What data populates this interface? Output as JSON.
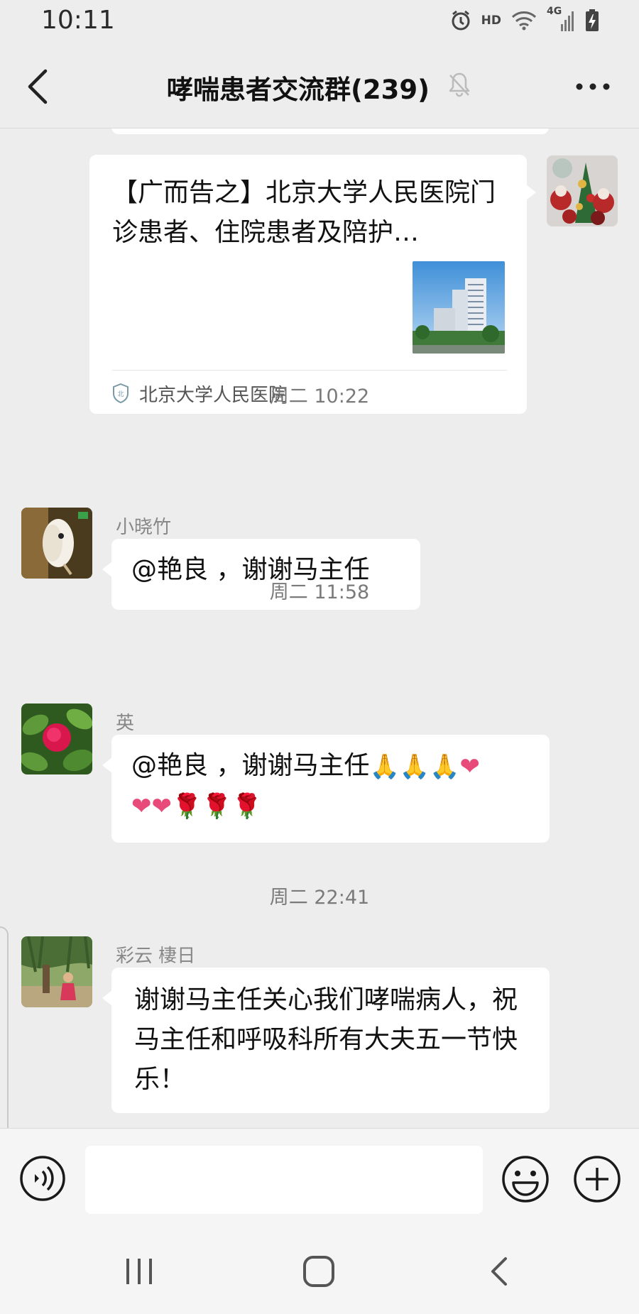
{
  "status_bar": {
    "time": "10:11",
    "hd": "HD",
    "network": "4G"
  },
  "header": {
    "title": "哮喘患者交流群(239)"
  },
  "messages": {
    "card": {
      "title": "【广而告之】北京大学人民医院门诊患者、住院患者及陪护…",
      "source": "北京大学人民医院"
    },
    "time1": "周二 10:22",
    "msg1": {
      "sender": "小晓竹",
      "text": "@艳良 ，谢谢马主任"
    },
    "time2": "周二 11:58",
    "msg2": {
      "sender": "英",
      "text": "@艳良 ，谢谢马主任",
      "emojis": [
        "🙏",
        "🙏",
        "🙏",
        "❤",
        "❤",
        "❤",
        "🌹",
        "🌹",
        "🌹"
      ]
    },
    "time3": "周二 22:41",
    "msg3": {
      "sender": "彩云 棲日",
      "text": "谢谢马主任关心我们哮喘病人，祝马主任和呼吸科所有大夫五一节快乐！"
    }
  },
  "input_bar": {
    "value": ""
  },
  "colors": {
    "background": "#ededed",
    "bubble": "#ffffff",
    "timestamp": "#7a7a7a",
    "heart": "#e84a7a",
    "rose": "#c8102e"
  },
  "icons": [
    "back-icon",
    "mute-bell-icon",
    "more-dots-icon",
    "voice-icon",
    "emoji-icon",
    "plus-icon",
    "recent-apps-icon",
    "home-icon",
    "nav-back-icon"
  ]
}
